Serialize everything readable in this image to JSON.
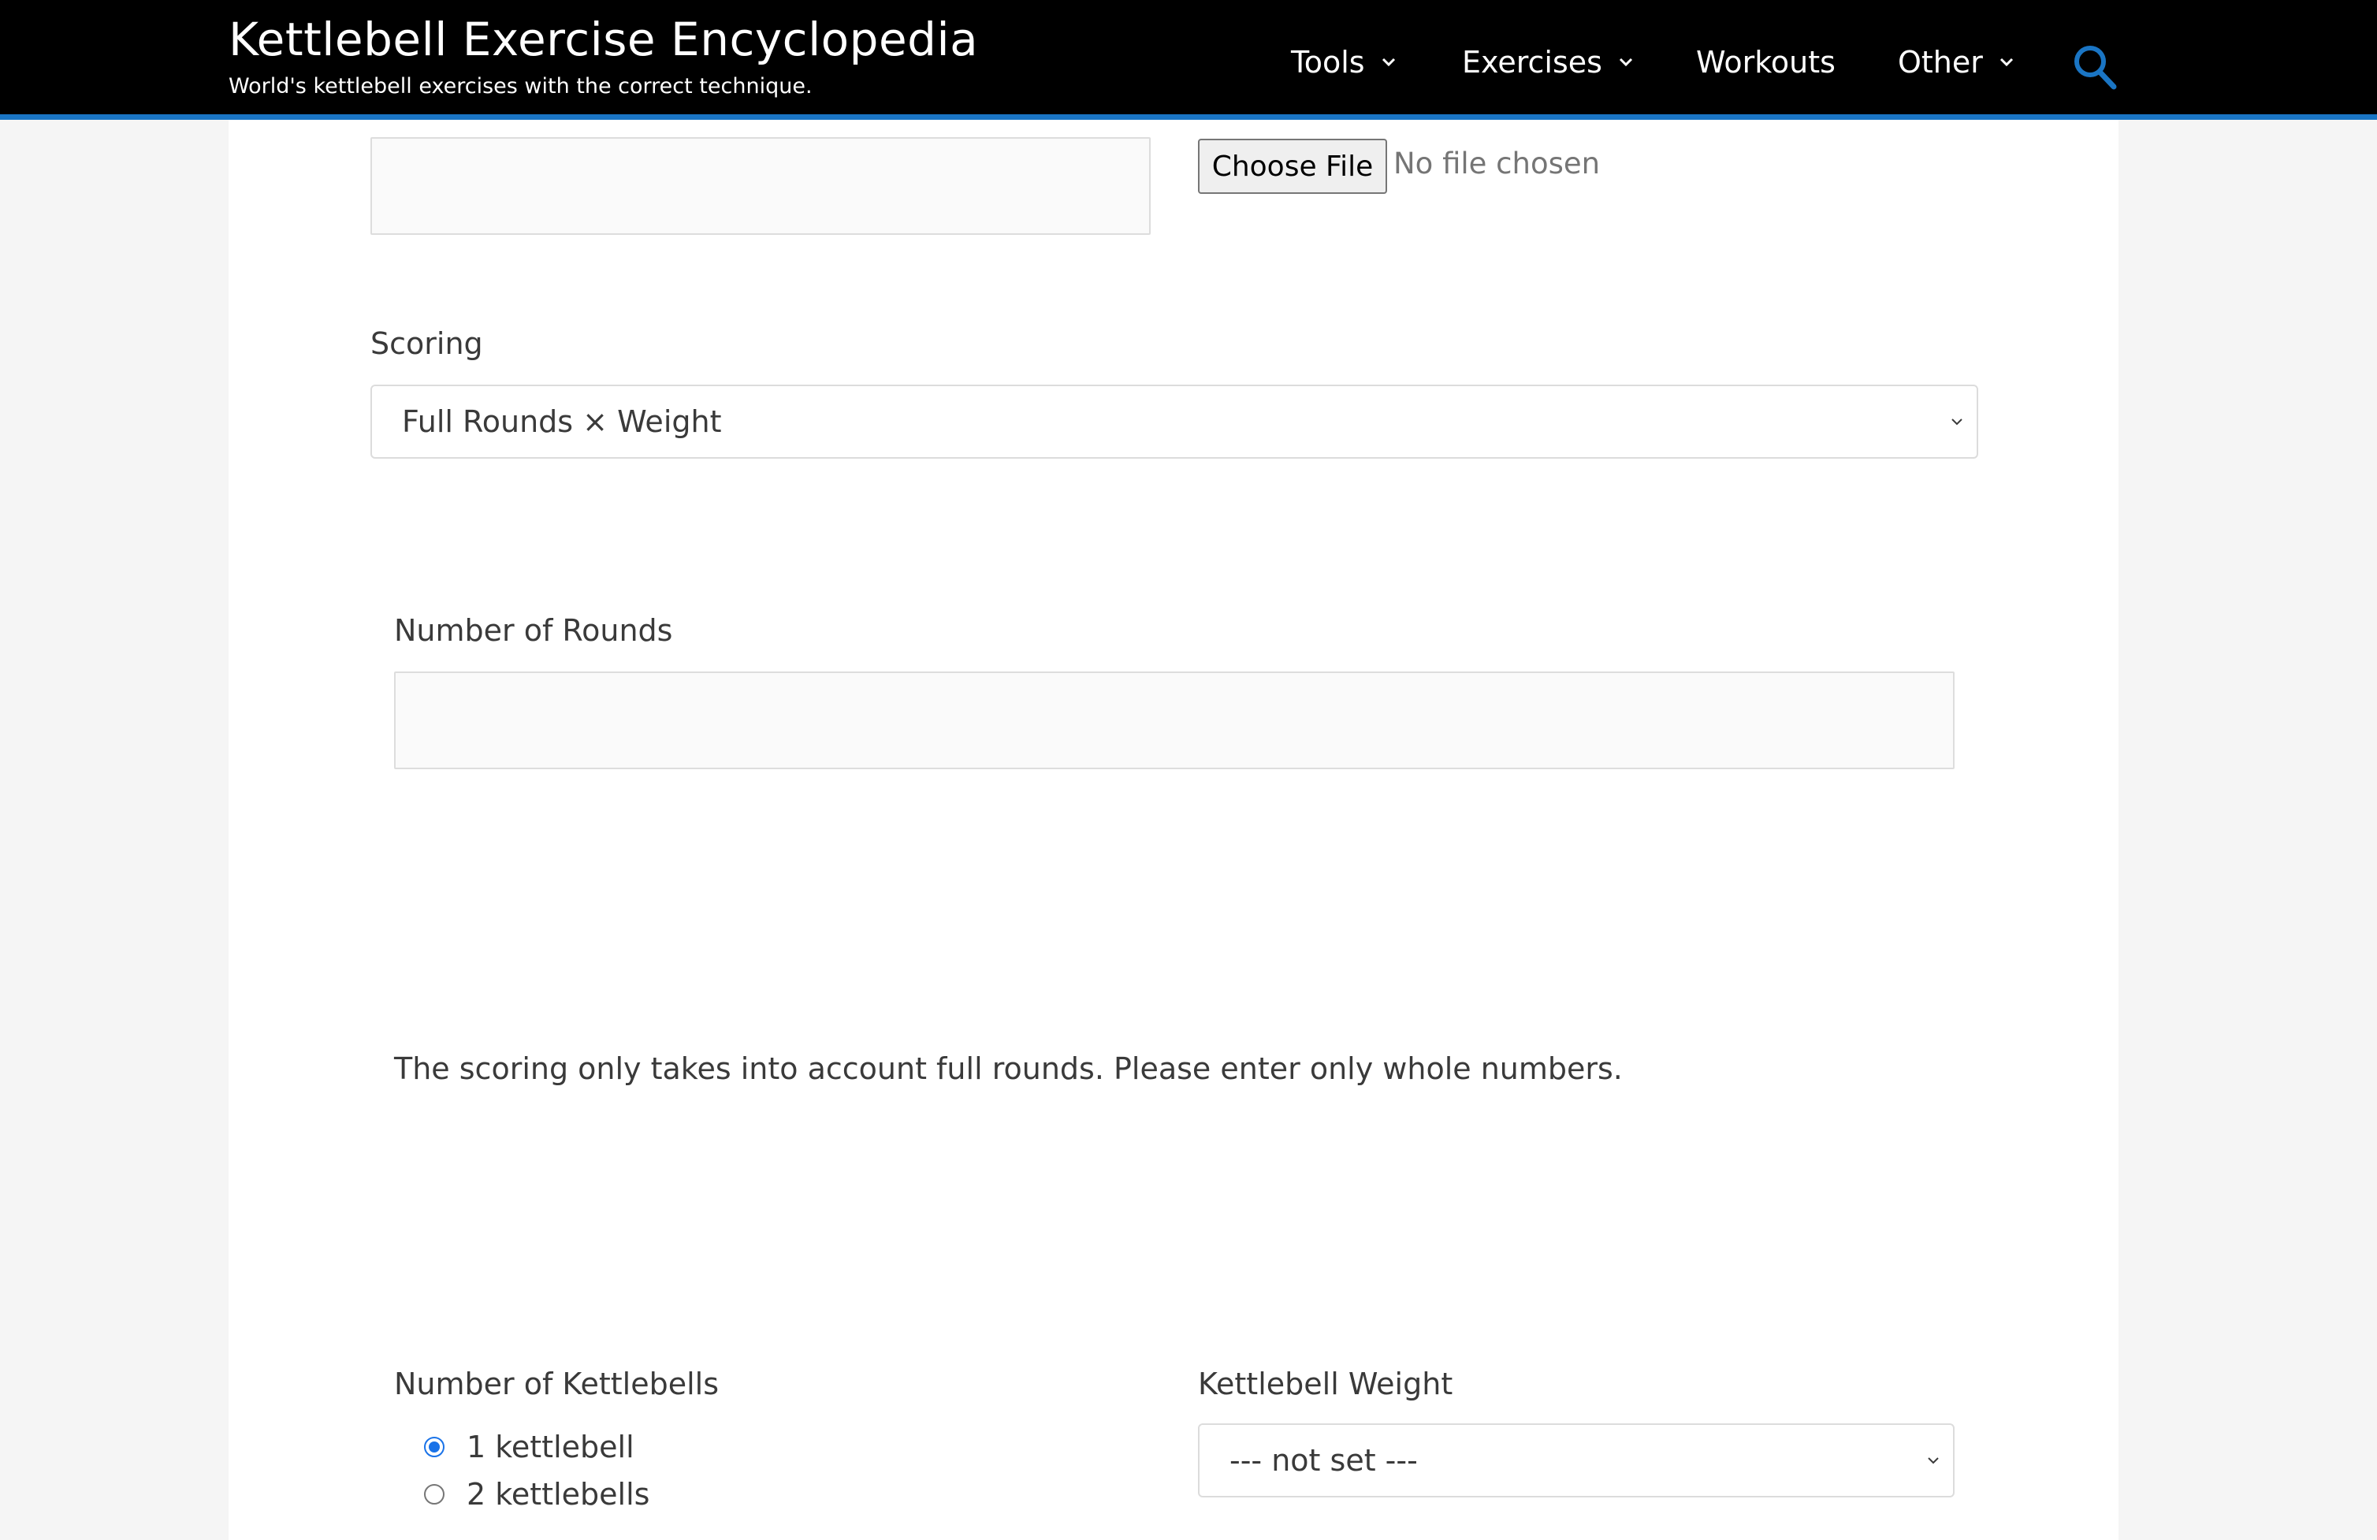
{
  "header": {
    "site_title": "Kettlebell Exercise Encyclopedia",
    "tagline": "World's kettlebell exercises with the correct technique.",
    "nav": [
      {
        "label": "Tools",
        "has_dropdown": true
      },
      {
        "label": "Exercises",
        "has_dropdown": true
      },
      {
        "label": "Workouts",
        "has_dropdown": false
      },
      {
        "label": "Other",
        "has_dropdown": true
      }
    ],
    "search_icon": "search-icon"
  },
  "form": {
    "file_upload": {
      "button_label": "Choose File",
      "status": "No file chosen"
    },
    "scoring": {
      "label": "Scoring",
      "selected": "Full Rounds × Weight"
    },
    "rounds": {
      "label": "Number of Rounds",
      "value": ""
    },
    "note": "The scoring only takes into account full rounds. Please enter only whole numbers.",
    "kettlebell_count": {
      "label": "Number of Kettlebells",
      "options": [
        {
          "label": "1 kettlebell",
          "checked": true
        },
        {
          "label": "2 kettlebells",
          "checked": false
        }
      ]
    },
    "kettlebell_weight": {
      "label": "Kettlebell Weight",
      "selected": "--- not set ---"
    }
  },
  "colors": {
    "header_bg": "#000000",
    "accent": "#1a75c4",
    "radio_checked": "#1a73e8"
  }
}
